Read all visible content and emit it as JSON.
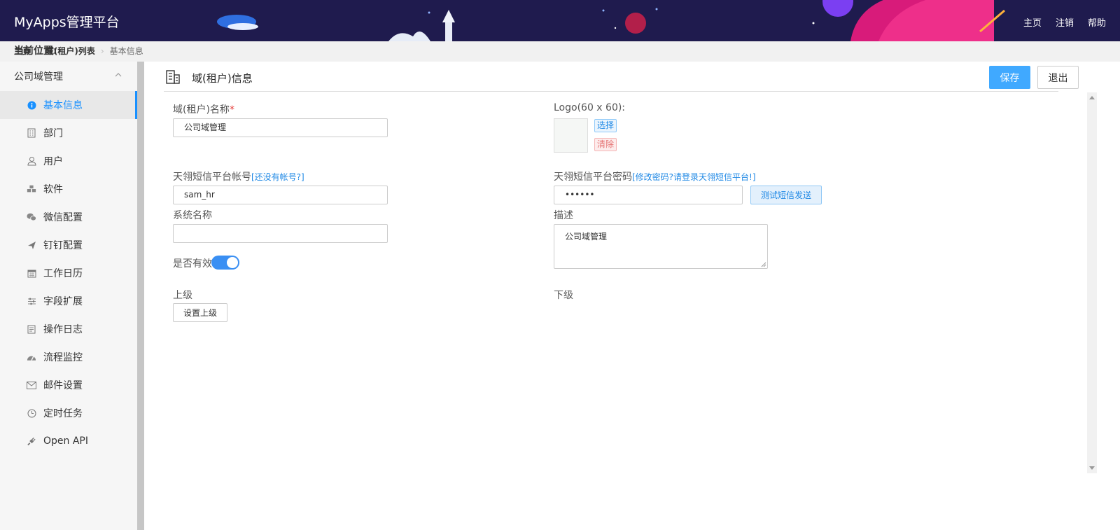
{
  "header": {
    "brand": "MyApps管理平台",
    "nav": [
      "主页",
      "注销",
      "帮助"
    ]
  },
  "breadcrumb": {
    "label": "当前位置:",
    "home": "主页",
    "list": "域(租户)列表",
    "current": "基本信息"
  },
  "sidebar": {
    "group": "公司域管理",
    "items": [
      {
        "label": "基本信息",
        "icon": "info-icon"
      },
      {
        "label": "部门",
        "icon": "building-icon"
      },
      {
        "label": "用户",
        "icon": "user-icon"
      },
      {
        "label": "软件",
        "icon": "cubes-icon"
      },
      {
        "label": "微信配置",
        "icon": "wechat-icon"
      },
      {
        "label": "钉钉配置",
        "icon": "plane-icon"
      },
      {
        "label": "工作日历",
        "icon": "calendar-icon"
      },
      {
        "label": "字段扩展",
        "icon": "sliders-icon"
      },
      {
        "label": "操作日志",
        "icon": "log-icon"
      },
      {
        "label": "流程监控",
        "icon": "dashboard-icon"
      },
      {
        "label": "邮件设置",
        "icon": "mail-icon"
      },
      {
        "label": "定时任务",
        "icon": "clock-icon"
      },
      {
        "label": "Open API",
        "icon": "plug-icon"
      }
    ]
  },
  "main": {
    "title": "域(租户)信息",
    "save": "保存",
    "exit": "退出"
  },
  "form": {
    "name_label": "域(租户)名称",
    "name_required": "*",
    "name_value": "公司域管理",
    "logo_label": "Logo(60 x 60):",
    "logo_select": "选择",
    "logo_clear": "清除",
    "sms_account_label": "天翎短信平台帐号",
    "sms_account_hint": "[还没有帐号?]",
    "sms_account_value": "sam_hr",
    "sms_password_label": "天翎短信平台密码",
    "sms_password_hint": "[修改密码?请登录天翎短信平台!]",
    "sms_password_value": "••••••",
    "sms_test": "测试短信发送",
    "system_name_label": "系统名称",
    "system_name_value": "",
    "description_label": "描述",
    "description_value": "公司域管理",
    "active_label": "是否有效",
    "active_value": true,
    "parent_label": "上级",
    "parent_button": "设置上级",
    "child_label": "下级"
  }
}
